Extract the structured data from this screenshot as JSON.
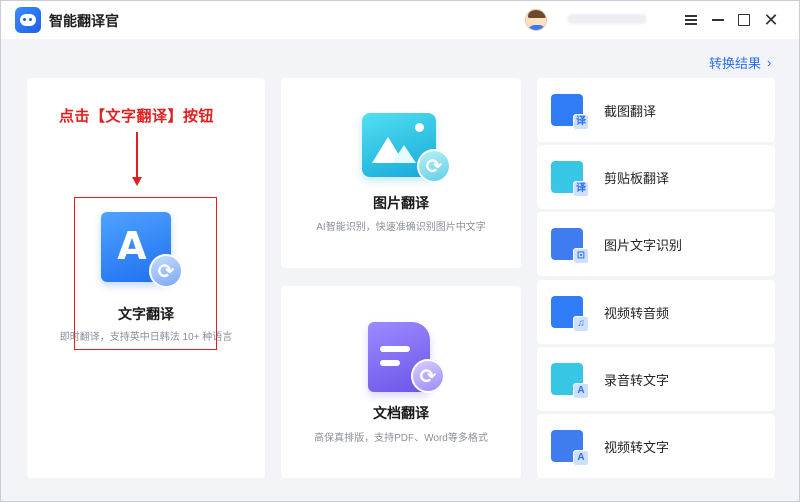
{
  "app": {
    "title": "智能翻译官"
  },
  "header": {
    "result_link": "转换结果",
    "result_chevron": "›"
  },
  "annotation": {
    "instruction": "点击【文字翻译】按钮"
  },
  "cards": {
    "text": {
      "title": "文字翻译",
      "desc": "即时翻译，支持英中日韩法 10+ 种语言",
      "icon_letter": "A"
    },
    "image": {
      "title": "图片翻译",
      "desc": "AI智能识别，快速准确识别图片中文字"
    },
    "doc": {
      "title": "文档翻译",
      "desc": "高保真排版，支持PDF、Word等多格式"
    }
  },
  "features": [
    {
      "label": "截图翻译",
      "icon": "screenshot-translate-icon",
      "badge": "译",
      "color": "#2f7cf6"
    },
    {
      "label": "剪贴板翻译",
      "icon": "clipboard-translate-icon",
      "badge": "译",
      "color": "#37c6e3"
    },
    {
      "label": "图片文字识别",
      "icon": "image-ocr-icon",
      "badge": "⊡",
      "color": "#3f7cf0"
    },
    {
      "label": "视频转音频",
      "icon": "video-to-audio-icon",
      "badge": "♫",
      "color": "#2f7cf6"
    },
    {
      "label": "录音转文字",
      "icon": "record-to-text-icon",
      "badge": "A",
      "color": "#37c6e3"
    },
    {
      "label": "视频转文字",
      "icon": "video-to-text-icon",
      "badge": "A",
      "color": "#3f7cf0"
    }
  ],
  "colors": {
    "accent": "#2c6df0",
    "annotation": "#e02020"
  },
  "window_controls": {
    "close": "✕"
  },
  "badge_glyph": "⟳"
}
